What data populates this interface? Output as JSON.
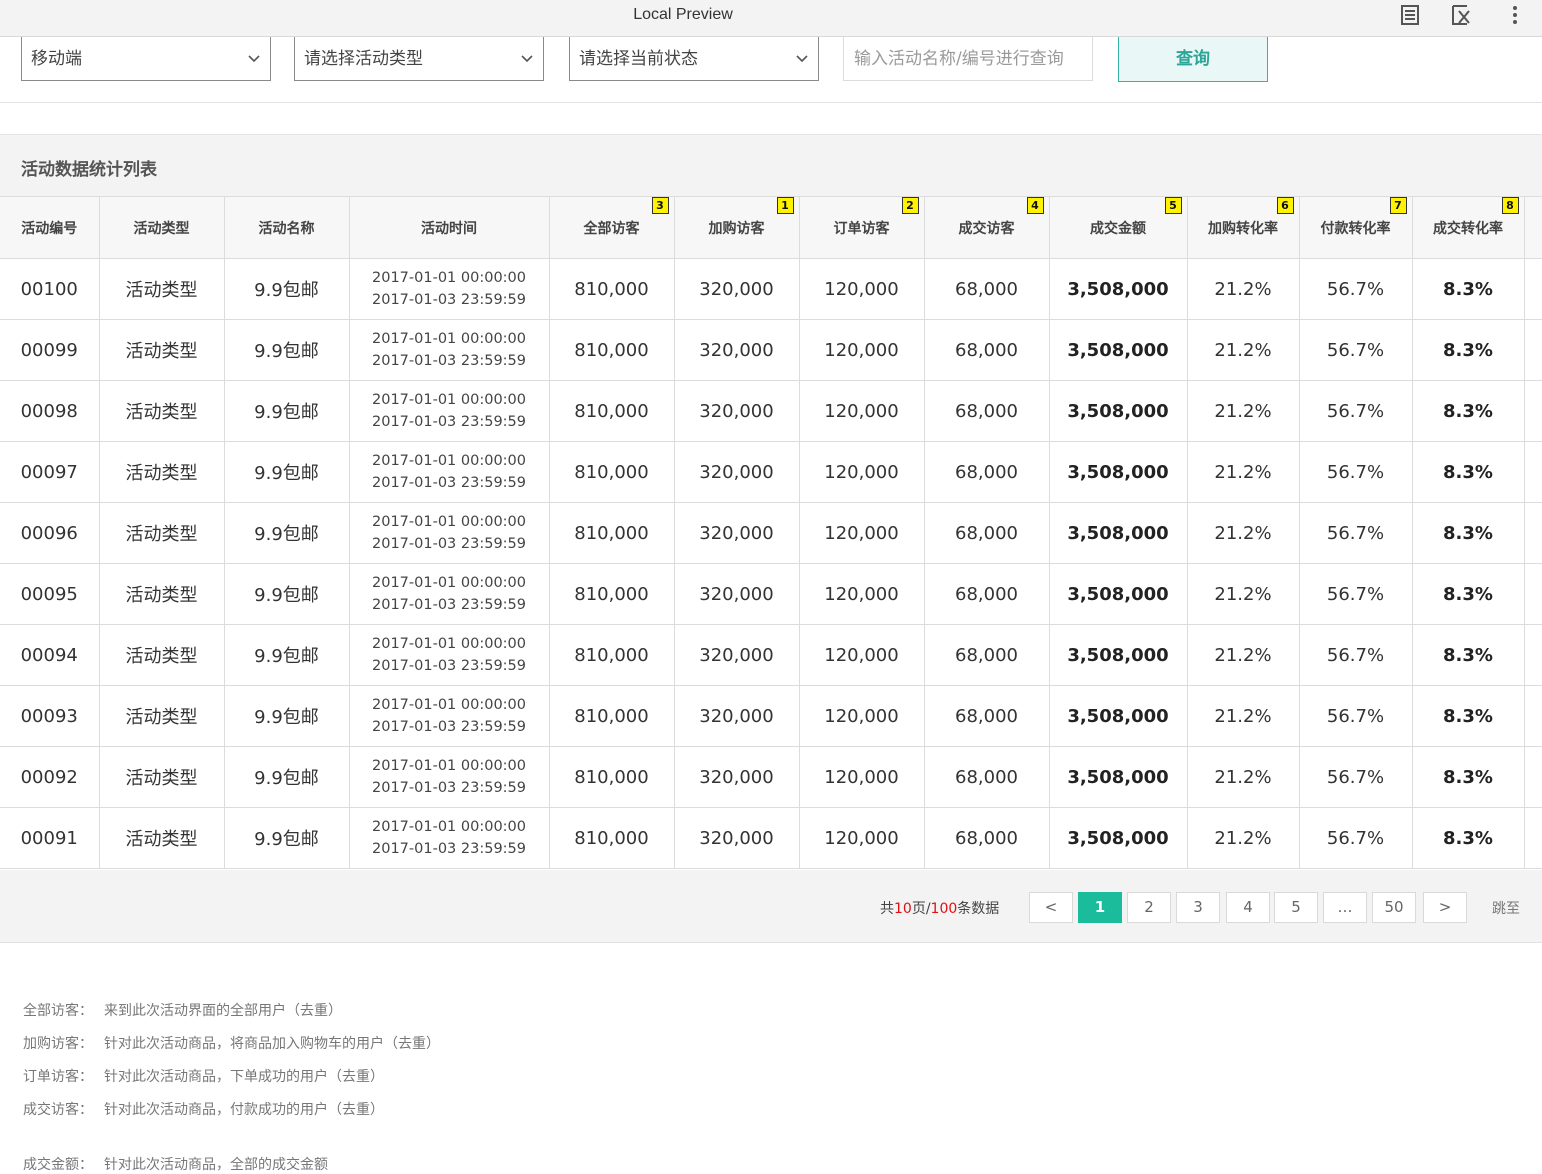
{
  "window": {
    "title": "Local Preview",
    "icons": [
      "doc-icon",
      "close-doc-icon",
      "kebab-menu-icon"
    ]
  },
  "filters": {
    "platform": "移动端",
    "activity_type": "请选择活动类型",
    "status": "请选择当前状态",
    "search_placeholder": "输入活动名称/编号进行查询",
    "query_label": "查询"
  },
  "section_title": "活动数据统计列表",
  "table": {
    "headers": [
      {
        "label": "活动编号",
        "badge": ""
      },
      {
        "label": "活动类型",
        "badge": ""
      },
      {
        "label": "活动名称",
        "badge": ""
      },
      {
        "label": "活动时间",
        "badge": ""
      },
      {
        "label": "全部访客",
        "badge": "3"
      },
      {
        "label": "加购访客",
        "badge": "1"
      },
      {
        "label": "订单访客",
        "badge": "2"
      },
      {
        "label": "成交访客",
        "badge": "4"
      },
      {
        "label": "成交金额",
        "badge": "5"
      },
      {
        "label": "加购转化率",
        "badge": "6"
      },
      {
        "label": "付款转化率",
        "badge": "7"
      },
      {
        "label": "成交转化率",
        "badge": "8"
      }
    ],
    "rows": [
      {
        "id": "00100",
        "type": "活动类型",
        "name": "9.9包邮",
        "start": "2017-01-01 00:00:00",
        "end": "2017-01-03 23:59:59",
        "all_visitors": "810,000",
        "cart_visitors": "320,000",
        "order_visitors": "120,000",
        "deal_visitors": "68,000",
        "deal_amount": "3,508,000",
        "cart_rate": "21.2%",
        "pay_rate": "56.7%",
        "deal_rate": "8.3%"
      },
      {
        "id": "00099",
        "type": "活动类型",
        "name": "9.9包邮",
        "start": "2017-01-01 00:00:00",
        "end": "2017-01-03 23:59:59",
        "all_visitors": "810,000",
        "cart_visitors": "320,000",
        "order_visitors": "120,000",
        "deal_visitors": "68,000",
        "deal_amount": "3,508,000",
        "cart_rate": "21.2%",
        "pay_rate": "56.7%",
        "deal_rate": "8.3%"
      },
      {
        "id": "00098",
        "type": "活动类型",
        "name": "9.9包邮",
        "start": "2017-01-01 00:00:00",
        "end": "2017-01-03 23:59:59",
        "all_visitors": "810,000",
        "cart_visitors": "320,000",
        "order_visitors": "120,000",
        "deal_visitors": "68,000",
        "deal_amount": "3,508,000",
        "cart_rate": "21.2%",
        "pay_rate": "56.7%",
        "deal_rate": "8.3%"
      },
      {
        "id": "00097",
        "type": "活动类型",
        "name": "9.9包邮",
        "start": "2017-01-01 00:00:00",
        "end": "2017-01-03 23:59:59",
        "all_visitors": "810,000",
        "cart_visitors": "320,000",
        "order_visitors": "120,000",
        "deal_visitors": "68,000",
        "deal_amount": "3,508,000",
        "cart_rate": "21.2%",
        "pay_rate": "56.7%",
        "deal_rate": "8.3%"
      },
      {
        "id": "00096",
        "type": "活动类型",
        "name": "9.9包邮",
        "start": "2017-01-01 00:00:00",
        "end": "2017-01-03 23:59:59",
        "all_visitors": "810,000",
        "cart_visitors": "320,000",
        "order_visitors": "120,000",
        "deal_visitors": "68,000",
        "deal_amount": "3,508,000",
        "cart_rate": "21.2%",
        "pay_rate": "56.7%",
        "deal_rate": "8.3%"
      },
      {
        "id": "00095",
        "type": "活动类型",
        "name": "9.9包邮",
        "start": "2017-01-01 00:00:00",
        "end": "2017-01-03 23:59:59",
        "all_visitors": "810,000",
        "cart_visitors": "320,000",
        "order_visitors": "120,000",
        "deal_visitors": "68,000",
        "deal_amount": "3,508,000",
        "cart_rate": "21.2%",
        "pay_rate": "56.7%",
        "deal_rate": "8.3%"
      },
      {
        "id": "00094",
        "type": "活动类型",
        "name": "9.9包邮",
        "start": "2017-01-01 00:00:00",
        "end": "2017-01-03 23:59:59",
        "all_visitors": "810,000",
        "cart_visitors": "320,000",
        "order_visitors": "120,000",
        "deal_visitors": "68,000",
        "deal_amount": "3,508,000",
        "cart_rate": "21.2%",
        "pay_rate": "56.7%",
        "deal_rate": "8.3%"
      },
      {
        "id": "00093",
        "type": "活动类型",
        "name": "9.9包邮",
        "start": "2017-01-01 00:00:00",
        "end": "2017-01-03 23:59:59",
        "all_visitors": "810,000",
        "cart_visitors": "320,000",
        "order_visitors": "120,000",
        "deal_visitors": "68,000",
        "deal_amount": "3,508,000",
        "cart_rate": "21.2%",
        "pay_rate": "56.7%",
        "deal_rate": "8.3%"
      },
      {
        "id": "00092",
        "type": "活动类型",
        "name": "9.9包邮",
        "start": "2017-01-01 00:00:00",
        "end": "2017-01-03 23:59:59",
        "all_visitors": "810,000",
        "cart_visitors": "320,000",
        "order_visitors": "120,000",
        "deal_visitors": "68,000",
        "deal_amount": "3,508,000",
        "cart_rate": "21.2%",
        "pay_rate": "56.7%",
        "deal_rate": "8.3%"
      },
      {
        "id": "00091",
        "type": "活动类型",
        "name": "9.9包邮",
        "start": "2017-01-01 00:00:00",
        "end": "2017-01-03 23:59:59",
        "all_visitors": "810,000",
        "cart_visitors": "320,000",
        "order_visitors": "120,000",
        "deal_visitors": "68,000",
        "deal_amount": "3,508,000",
        "cart_rate": "21.2%",
        "pay_rate": "56.7%",
        "deal_rate": "8.3%"
      }
    ]
  },
  "pagination": {
    "summary_prefix": "共",
    "total_pages": "10",
    "pages_unit": "页/",
    "total_records": "100",
    "records_unit": "条数据",
    "prev": "<",
    "pages": [
      "1",
      "2",
      "3",
      "4",
      "5",
      "…",
      "50"
    ],
    "next": ">",
    "current": "1",
    "jump_label": "跳至"
  },
  "notes": [
    {
      "key": "全部访客：",
      "text": "来到此次活动界面的全部用户（去重）"
    },
    {
      "key": "加购访客：",
      "text": "针对此次活动商品，将商品加入购物车的用户（去重）"
    },
    {
      "key": "订单访客：",
      "text": "针对此次活动商品，下单成功的用户（去重）"
    },
    {
      "key": "成交访客：",
      "text": "针对此次活动商品，付款成功的用户（去重）"
    },
    {
      "key": "成交金额：",
      "text": "针对此次活动商品，全部的成交金额"
    }
  ],
  "colors": {
    "accent": "#1bbc9b",
    "query_text": "#2da597",
    "badge": "#fff200",
    "summary_highlight": "#e01010"
  }
}
